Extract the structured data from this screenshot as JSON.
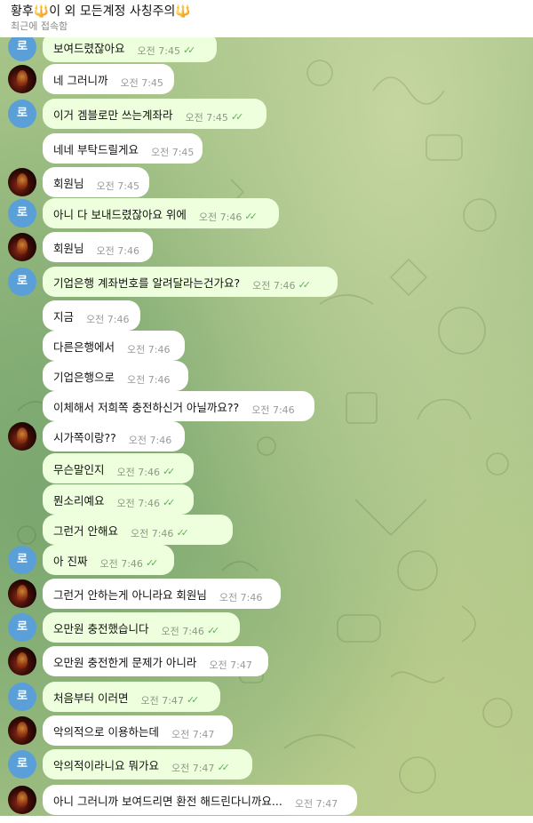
{
  "header": {
    "title_prefix": "황후",
    "title_mid": "이 외 모든계정 사칭주의",
    "trident": "🔱",
    "status": "최근에 접속함"
  },
  "avatar_letter": "로",
  "checkmark": "✓✓",
  "messages": [
    {
      "text": "보여드렸잖아요",
      "time": "오전 7:45"
    },
    {
      "text": "네 그러니까",
      "time": "오전 7:45"
    },
    {
      "text": "이거 겜블로만 쓰는계좌라",
      "time": "오전 7:45"
    },
    {
      "text": "네네 부탁드릴게요",
      "time": "오전 7:45"
    },
    {
      "text": "회원님",
      "time": "오전 7:45"
    },
    {
      "text": "아니 다 보내드렸잖아요 위에",
      "time": "오전 7:46"
    },
    {
      "text": "회원님",
      "time": "오전 7:46"
    },
    {
      "text": "기업은행 계좌번호를 알려달라는건가요?",
      "time": "오전 7:46"
    },
    {
      "text": "지금",
      "time": "오전 7:46"
    },
    {
      "text": "다른은행에서",
      "time": "오전 7:46"
    },
    {
      "text": "기업은행으로",
      "time": "오전 7:46"
    },
    {
      "text": "이체해서 저희쪽 충전하신거 아닐까요??",
      "time": "오전 7:46"
    },
    {
      "text": "시가쪽이랑??",
      "time": "오전 7:46"
    },
    {
      "text": "무슨말인지",
      "time": "오전 7:46"
    },
    {
      "text": "뭔소리예요",
      "time": "오전 7:46"
    },
    {
      "text": "그런거 안해요",
      "time": "오전 7:46"
    },
    {
      "text": "아 진짜",
      "time": "오전 7:46"
    },
    {
      "text": "그런거 안하는게 아니라요 회원님",
      "time": "오전 7:46"
    },
    {
      "text": "오만원 충전했습니다",
      "time": "오전 7:46"
    },
    {
      "text": "오만원 충전한게 문제가 아니라",
      "time": "오전 7:47"
    },
    {
      "text": "처음부터 이러면",
      "time": "오전 7:47"
    },
    {
      "text": "악의적으로 이용하는데",
      "time": "오전 7:47"
    },
    {
      "text": "악의적이라니요 뭐가요",
      "time": "오전 7:47"
    },
    {
      "text": "아니 그러니까 보여드리면 환전 해드린다니까요...",
      "time": "오전 7:47"
    }
  ]
}
